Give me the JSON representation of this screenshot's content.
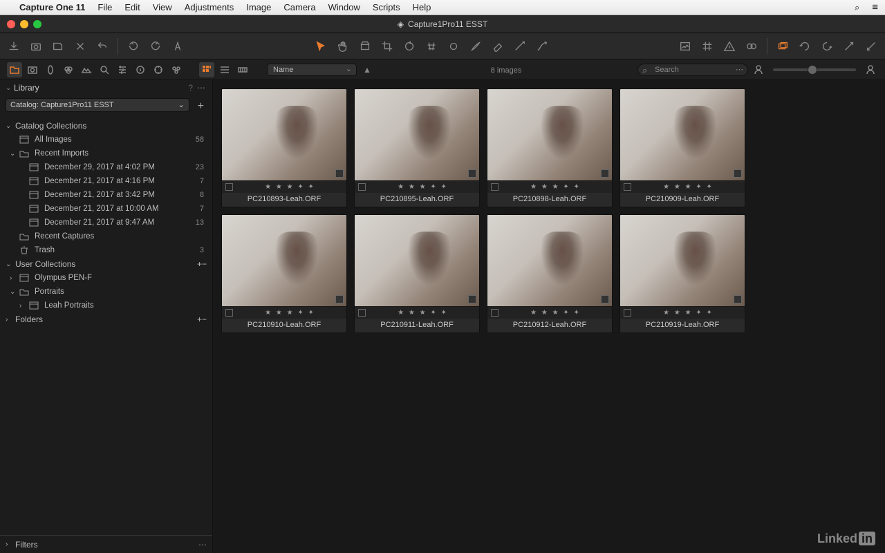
{
  "menubar": {
    "app": "Capture One 11",
    "items": [
      "File",
      "Edit",
      "View",
      "Adjustments",
      "Image",
      "Camera",
      "Window",
      "Scripts",
      "Help"
    ]
  },
  "window": {
    "title": "Capture1Pro11 ESST"
  },
  "sidebar": {
    "panel_title": "Library",
    "catalog_label": "Catalog: Capture1Pro11 ESST",
    "catalog_collections": {
      "title": "Catalog Collections",
      "all_images": {
        "label": "All Images",
        "count": "58"
      },
      "recent_imports": {
        "label": "Recent Imports"
      },
      "imports": [
        {
          "label": "December 29, 2017 at 4:02 PM",
          "count": "23"
        },
        {
          "label": "December 21, 2017 at 4:16 PM",
          "count": "7"
        },
        {
          "label": "December 21, 2017 at 3:42 PM",
          "count": "8"
        },
        {
          "label": "December 21, 2017 at 10:00 AM",
          "count": "7"
        },
        {
          "label": "December 21, 2017 at 9:47 AM",
          "count": "13"
        }
      ],
      "recent_captures": {
        "label": "Recent Captures"
      },
      "trash": {
        "label": "Trash",
        "count": "3"
      }
    },
    "user_collections": {
      "title": "User Collections",
      "items": [
        {
          "label": "Olympus PEN-F"
        },
        {
          "label": "Portraits"
        },
        {
          "label": "Leah Portraits"
        }
      ]
    },
    "folders": {
      "title": "Folders"
    },
    "filters": {
      "title": "Filters"
    }
  },
  "browser": {
    "sort_mode": "Name",
    "image_count": "8 images",
    "search_placeholder": "Search",
    "thumbs": [
      {
        "fn": "PC210893-Leah.ORF",
        "stars": "★ ★ ★ ✦ ✦"
      },
      {
        "fn": "PC210895-Leah.ORF",
        "stars": "★ ★ ★ ✦ ✦"
      },
      {
        "fn": "PC210898-Leah.ORF",
        "stars": "★ ★ ★ ✦ ✦"
      },
      {
        "fn": "PC210909-Leah.ORF",
        "stars": "★ ★ ★ ✦ ✦"
      },
      {
        "fn": "PC210910-Leah.ORF",
        "stars": "★ ★ ★ ✦ ✦"
      },
      {
        "fn": "PC210911-Leah.ORF",
        "stars": "★ ★ ★ ✦ ✦"
      },
      {
        "fn": "PC210912-Leah.ORF",
        "stars": "★ ★ ★ ✦ ✦"
      },
      {
        "fn": "PC210919-Leah.ORF",
        "stars": "★ ★ ★ ✦ ✦"
      }
    ]
  },
  "footer": {
    "brand": "Linked",
    "brand2": "in"
  }
}
